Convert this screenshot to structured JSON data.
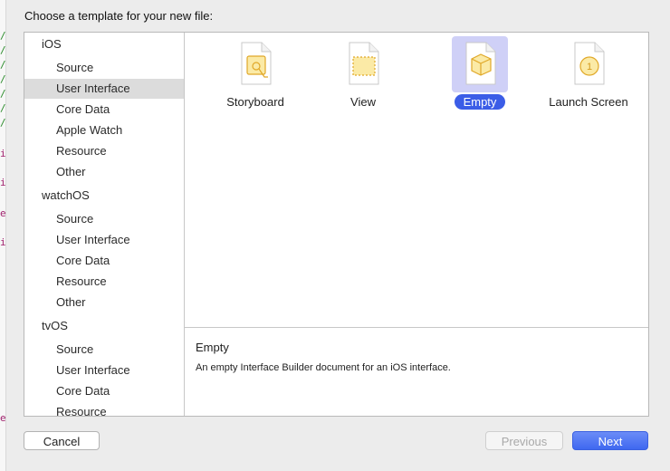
{
  "dialog": {
    "prompt": "Choose a template for your new file:"
  },
  "sidebar": {
    "sections": [
      {
        "platform": "iOS",
        "items": [
          "Source",
          "User Interface",
          "Core Data",
          "Apple Watch",
          "Resource",
          "Other"
        ]
      },
      {
        "platform": "watchOS",
        "items": [
          "Source",
          "User Interface",
          "Core Data",
          "Resource",
          "Other"
        ]
      },
      {
        "platform": "tvOS",
        "items": [
          "Source",
          "User Interface",
          "Core Data",
          "Resource"
        ]
      }
    ],
    "selected": "User Interface"
  },
  "templates": [
    {
      "label": "Storyboard",
      "icon": "storyboard-icon"
    },
    {
      "label": "View",
      "icon": "view-icon"
    },
    {
      "label": "Empty",
      "icon": "empty-icon",
      "selected": true
    },
    {
      "label": "Launch Screen",
      "icon": "launch-screen-icon"
    }
  ],
  "description": {
    "title": "Empty",
    "text": "An empty Interface Builder document for an iOS interface."
  },
  "buttons": {
    "cancel": "Cancel",
    "previous": "Previous",
    "next": "Next"
  },
  "colors": {
    "selection_blue": "#3b5de7",
    "selection_tint": "#cfd0f7",
    "icon_yellow": "#f2c23a"
  }
}
